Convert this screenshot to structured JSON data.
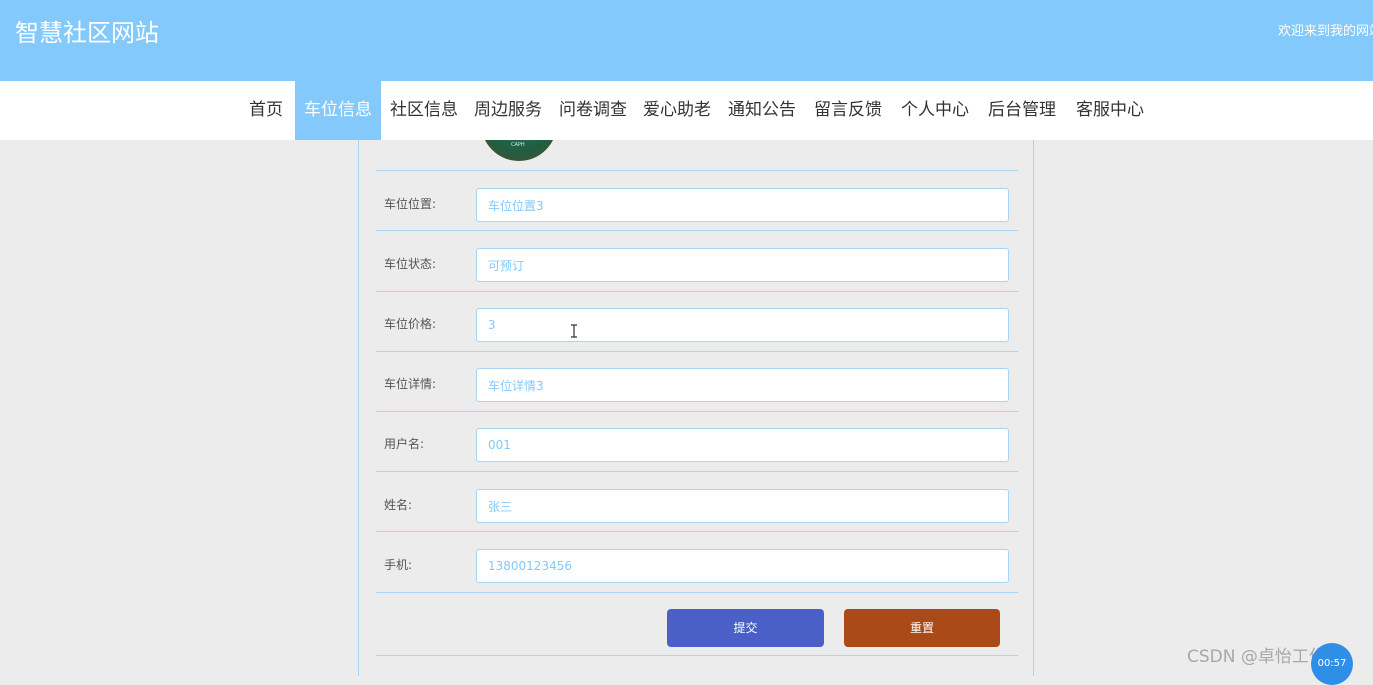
{
  "header": {
    "site_title": "智慧社区网站",
    "welcome_text": "欢迎来到我的网站"
  },
  "nav": {
    "items": [
      {
        "label": "首页",
        "active": false
      },
      {
        "label": "车位信息",
        "active": true
      },
      {
        "label": "社区信息",
        "active": false
      },
      {
        "label": "周边服务",
        "active": false
      },
      {
        "label": "问卷调查",
        "active": false
      },
      {
        "label": "爱心助老",
        "active": false
      },
      {
        "label": "通知公告",
        "active": false
      },
      {
        "label": "留言反馈",
        "active": false
      },
      {
        "label": "个人中心",
        "active": false
      },
      {
        "label": "后台管理",
        "active": false
      },
      {
        "label": "客服中心",
        "active": false
      }
    ]
  },
  "form": {
    "avatar_text": "CAPH",
    "fields": [
      {
        "label": "车位位置:",
        "value": "车位位置3"
      },
      {
        "label": "车位状态:",
        "value": "可预订"
      },
      {
        "label": "车位价格:",
        "value": "3"
      },
      {
        "label": "车位详情:",
        "value": "车位详情3"
      },
      {
        "label": "用户名:",
        "value": "001"
      },
      {
        "label": "姓名:",
        "value": "张三"
      },
      {
        "label": "手机:",
        "value": "13800123456"
      }
    ],
    "submit_label": "提交",
    "reset_label": "重置"
  },
  "watermark": "CSDN @卓怡工作室",
  "fab_text": "00:57",
  "colors": {
    "header_bg": "#84c9fb",
    "submit_bg": "#4a5fc7",
    "reset_bg": "#aa4a18",
    "border": "#a9d5f2"
  },
  "icons": {
    "text_cursor": "text-cursor-icon"
  }
}
